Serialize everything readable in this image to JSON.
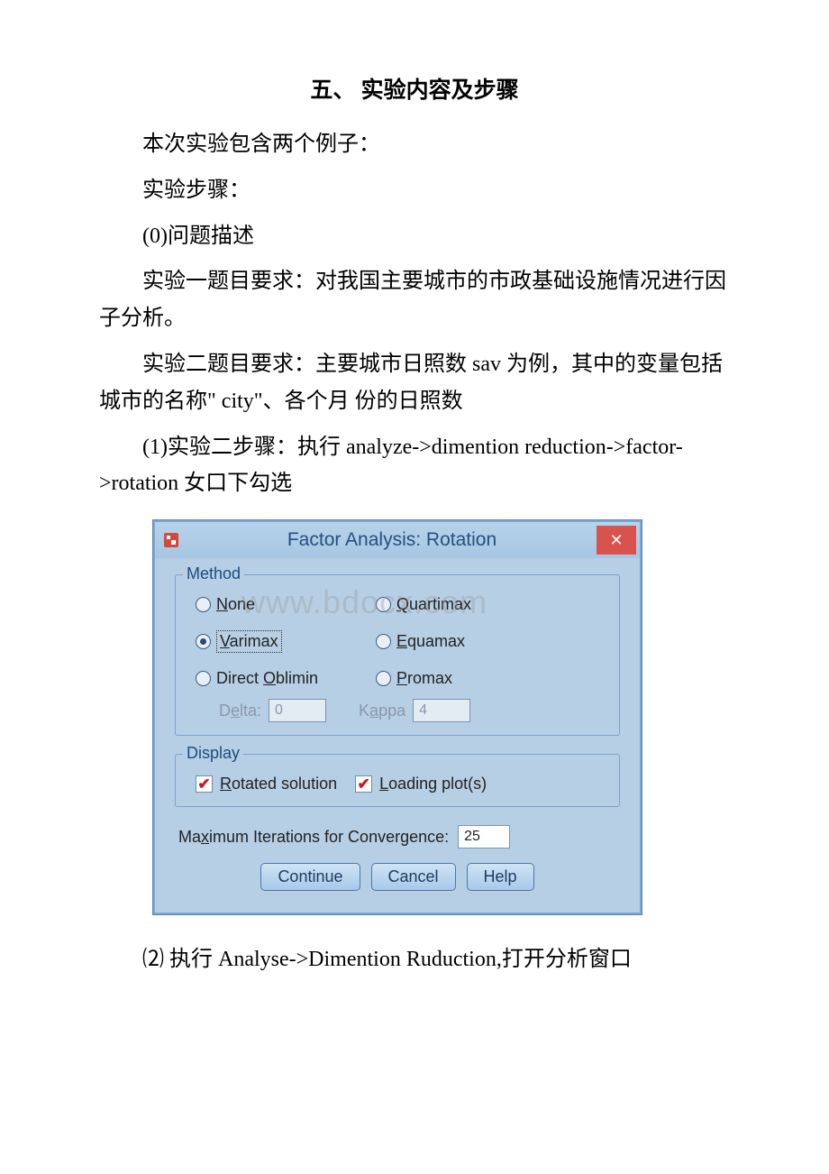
{
  "doc": {
    "title": "五、 实验内容及步骤",
    "p1": "本次实验包含两个例子：",
    "p2": "实验步骤：",
    "p3": "(0)问题描述",
    "p4": "实验一题目要求：对我国主要城市的市政基础设施情况进行因子分析。",
    "p5": "实验二题目要求：主要城市日照数 sav 为例，其中的变量包括城市的名称\" city\"、各个月 份的日照数",
    "p6a": "(1)实验二步骤：执行 analyze->dimention reduction->factor->rotation 女口下勾选",
    "p7": "⑵ 执行 Analyse->Dimention Ruduction,打开分析窗口"
  },
  "dialog": {
    "title": "Factor Analysis: Rotation",
    "watermark": "www.bdocx.com",
    "method": {
      "legend": "Method",
      "none_pre": "N",
      "none_rest": "one",
      "quartimax_pre": "Q",
      "quartimax_rest": "uartimax",
      "varimax_pre": "V",
      "varimax_rest": "arimax",
      "equamax_pre": "E",
      "equamax_rest": "quamax",
      "direct_pre": "Direct ",
      "direct_u": "O",
      "direct_rest": "blimin",
      "promax_pre": "P",
      "promax_rest": "romax",
      "delta_pre": "D",
      "delta_u": "e",
      "delta_rest": "lta:",
      "delta_val": "0",
      "kappa_pre": "K",
      "kappa_u": "a",
      "kappa_rest": "ppa",
      "kappa_val": "4"
    },
    "display": {
      "legend": "Display",
      "rotated_pre": "R",
      "rotated_rest": "otated solution",
      "loading_pre": "L",
      "loading_rest": "oading plot(s)"
    },
    "maxiter": {
      "label_pre": "Ma",
      "label_u": "x",
      "label_rest": "imum Iterations for Convergence:",
      "value": "25"
    },
    "buttons": {
      "continue": "Continue",
      "cancel": "Cancel",
      "help": "Help"
    }
  }
}
